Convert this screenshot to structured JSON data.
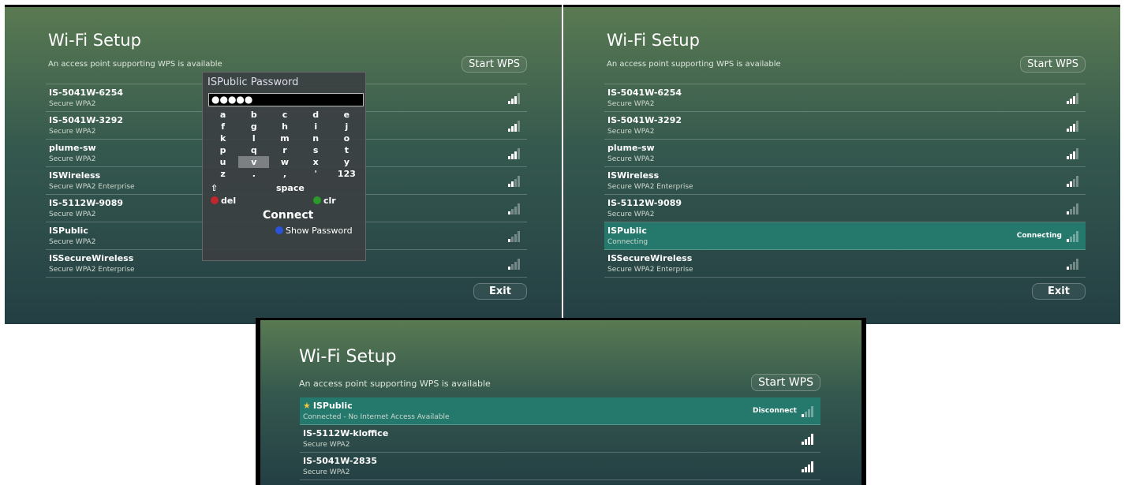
{
  "screens": {
    "left": {
      "title": "Wi-Fi Setup",
      "wps_note": "An access point supporting WPS is available",
      "start_wps": "Start WPS",
      "exit": "Exit",
      "networks": [
        {
          "name": "IS-5041W-6254",
          "security": "Secure WPA2",
          "signal": 3
        },
        {
          "name": "IS-5041W-3292",
          "security": "Secure WPA2",
          "signal": 3
        },
        {
          "name": "plume-sw",
          "security": "Secure WPA2",
          "signal": 3
        },
        {
          "name": "ISWireless",
          "security": "Secure WPA2 Enterprise",
          "signal": 2
        },
        {
          "name": "IS-5112W-9089",
          "security": "Secure WPA2",
          "signal": 1
        },
        {
          "name": "ISPublic",
          "security": "Secure WPA2",
          "signal": 1
        },
        {
          "name": "ISSecureWireless",
          "security": "Secure WPA2 Enterprise",
          "signal": 1
        }
      ],
      "keyboard": {
        "title": "ISPublic Password",
        "password_mask": "●●●●●",
        "rows": [
          [
            "a",
            "b",
            "c",
            "d",
            "e"
          ],
          [
            "f",
            "g",
            "h",
            "i",
            "j"
          ],
          [
            "k",
            "l",
            "m",
            "n",
            "o"
          ],
          [
            "p",
            "q",
            "r",
            "s",
            "t"
          ],
          [
            "u",
            "v",
            "w",
            "x",
            "y"
          ],
          [
            "z",
            ".",
            ",",
            "'",
            "123"
          ]
        ],
        "highlighted_key": "v",
        "shift_icon": "shift-icon",
        "space": "space",
        "del": "del",
        "clr": "clr",
        "connect": "Connect",
        "show_password": "Show Password"
      }
    },
    "right": {
      "title": "Wi-Fi Setup",
      "wps_note": "An access point supporting WPS is available",
      "start_wps": "Start WPS",
      "exit": "Exit",
      "networks": [
        {
          "name": "IS-5041W-6254",
          "security": "Secure WPA2",
          "signal": 3
        },
        {
          "name": "IS-5041W-3292",
          "security": "Secure WPA2",
          "signal": 3
        },
        {
          "name": "plume-sw",
          "security": "Secure WPA2",
          "signal": 3
        },
        {
          "name": "ISWireless",
          "security": "Secure WPA2 Enterprise",
          "signal": 2
        },
        {
          "name": "IS-5112W-9089",
          "security": "Secure WPA2",
          "signal": 1
        },
        {
          "name": "ISPublic",
          "security": "Connecting",
          "signal": 1,
          "status": "Connecting",
          "selected": true
        },
        {
          "name": "ISSecureWireless",
          "security": "Secure WPA2 Enterprise",
          "signal": 1
        }
      ]
    },
    "bottom": {
      "title": "Wi-Fi Setup",
      "wps_note": "An access point supporting WPS is available",
      "start_wps": "Start WPS",
      "networks": [
        {
          "name": "ISPublic",
          "security": "Connected - No Internet Access Available",
          "signal": 1,
          "status": "Disconnect",
          "selected": true,
          "star": "★"
        },
        {
          "name": "IS-5112W-kloffice",
          "security": "Secure WPA2",
          "signal": 3
        },
        {
          "name": "IS-5041W-2835",
          "security": "Secure WPA2",
          "signal": 3
        }
      ]
    }
  },
  "colors": {
    "selected_row": "#24796c",
    "del_dot": "#c0262c",
    "clr_dot": "#2a9a2a",
    "show_dot": "#2b53d8"
  }
}
